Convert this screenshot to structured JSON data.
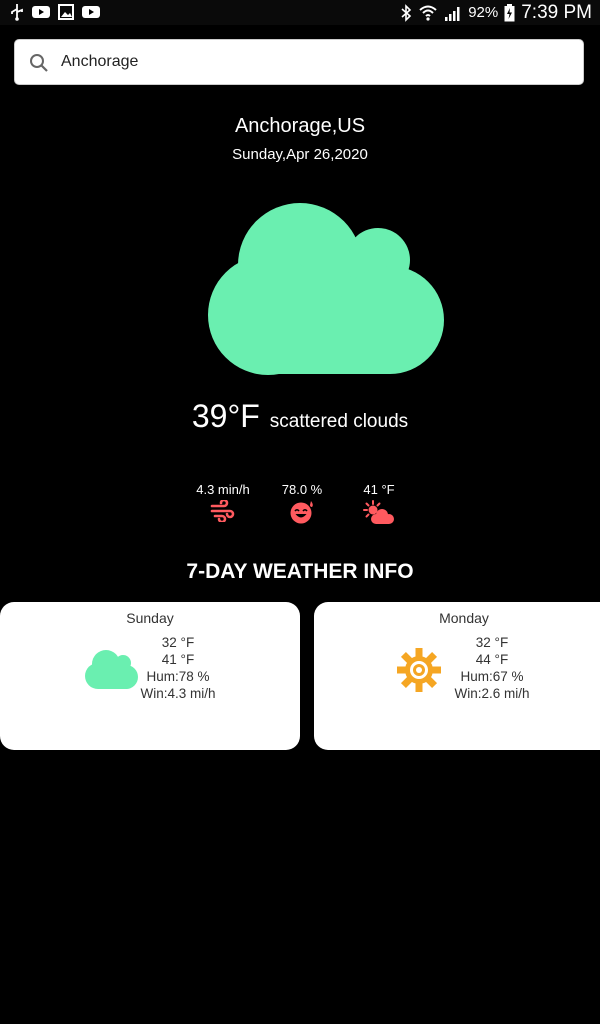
{
  "status_bar": {
    "battery": "92%",
    "time": "7:39 PM",
    "left_icons": [
      "usb-icon",
      "youtube-icon",
      "image-icon",
      "youtube-icon"
    ],
    "right_icons": [
      "bluetooth-icon",
      "wifi-icon",
      "signal-icon",
      "battery-charging-icon"
    ]
  },
  "search": {
    "value": "Anchorage",
    "icon": "search-icon"
  },
  "current": {
    "city": "Anchorage,US",
    "date": "Sunday,Apr 26,2020",
    "temperature": "39°F",
    "description": "scattered clouds",
    "icon": "cloud-icon",
    "icon_color": "#6aefb0"
  },
  "stats": [
    {
      "value": "4.3 min/h",
      "icon": "wind-icon"
    },
    {
      "value": "78.0 %",
      "icon": "humidity-face-icon"
    },
    {
      "value": "41 °F",
      "icon": "sun-cloud-icon"
    }
  ],
  "stat_icon_color": "#ff5a5f",
  "section_title": "7-DAY WEATHER INFO",
  "forecast": [
    {
      "day": "Sunday",
      "min": "32 °F",
      "max": "41 °F",
      "humidity": "Hum:78 %",
      "wind": "Win:4.3 mi/h",
      "icon": "cloud-icon",
      "icon_color": "#6aefb0"
    },
    {
      "day": "Monday",
      "min": "32 °F",
      "max": "44 °F",
      "humidity": "Hum:67 %",
      "wind": "Win:2.6 mi/h",
      "icon": "sun-icon",
      "icon_color": "#f5a623"
    }
  ]
}
